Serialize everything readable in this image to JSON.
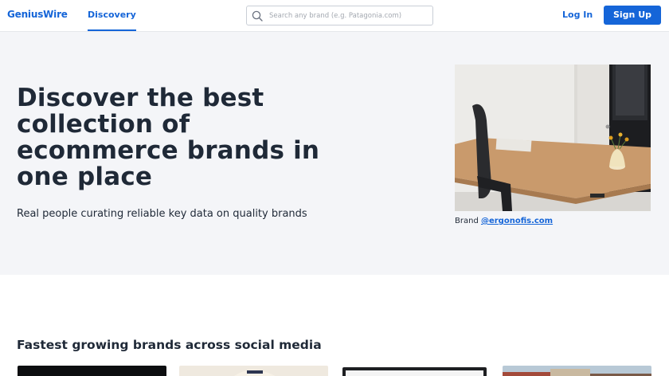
{
  "header": {
    "logo": "GeniusWire",
    "tab": "Discovery",
    "search_placeholder": "Search any brand (e.g. Patagonia.com)",
    "login_label": "Log In",
    "signup_label": "Sign Up"
  },
  "hero": {
    "title": "Discover the best collection of ecommerce brands in one place",
    "subtitle": "Real people curating reliable key data on quality brands",
    "caption_prefix": "Brand ",
    "caption_link": "@ergonofis.com"
  },
  "section": {
    "title": "Fastest growing brands across social media"
  },
  "colors": {
    "brand": "#1565d8",
    "hero_bg": "#f4f5f8",
    "text": "#1f2937"
  }
}
